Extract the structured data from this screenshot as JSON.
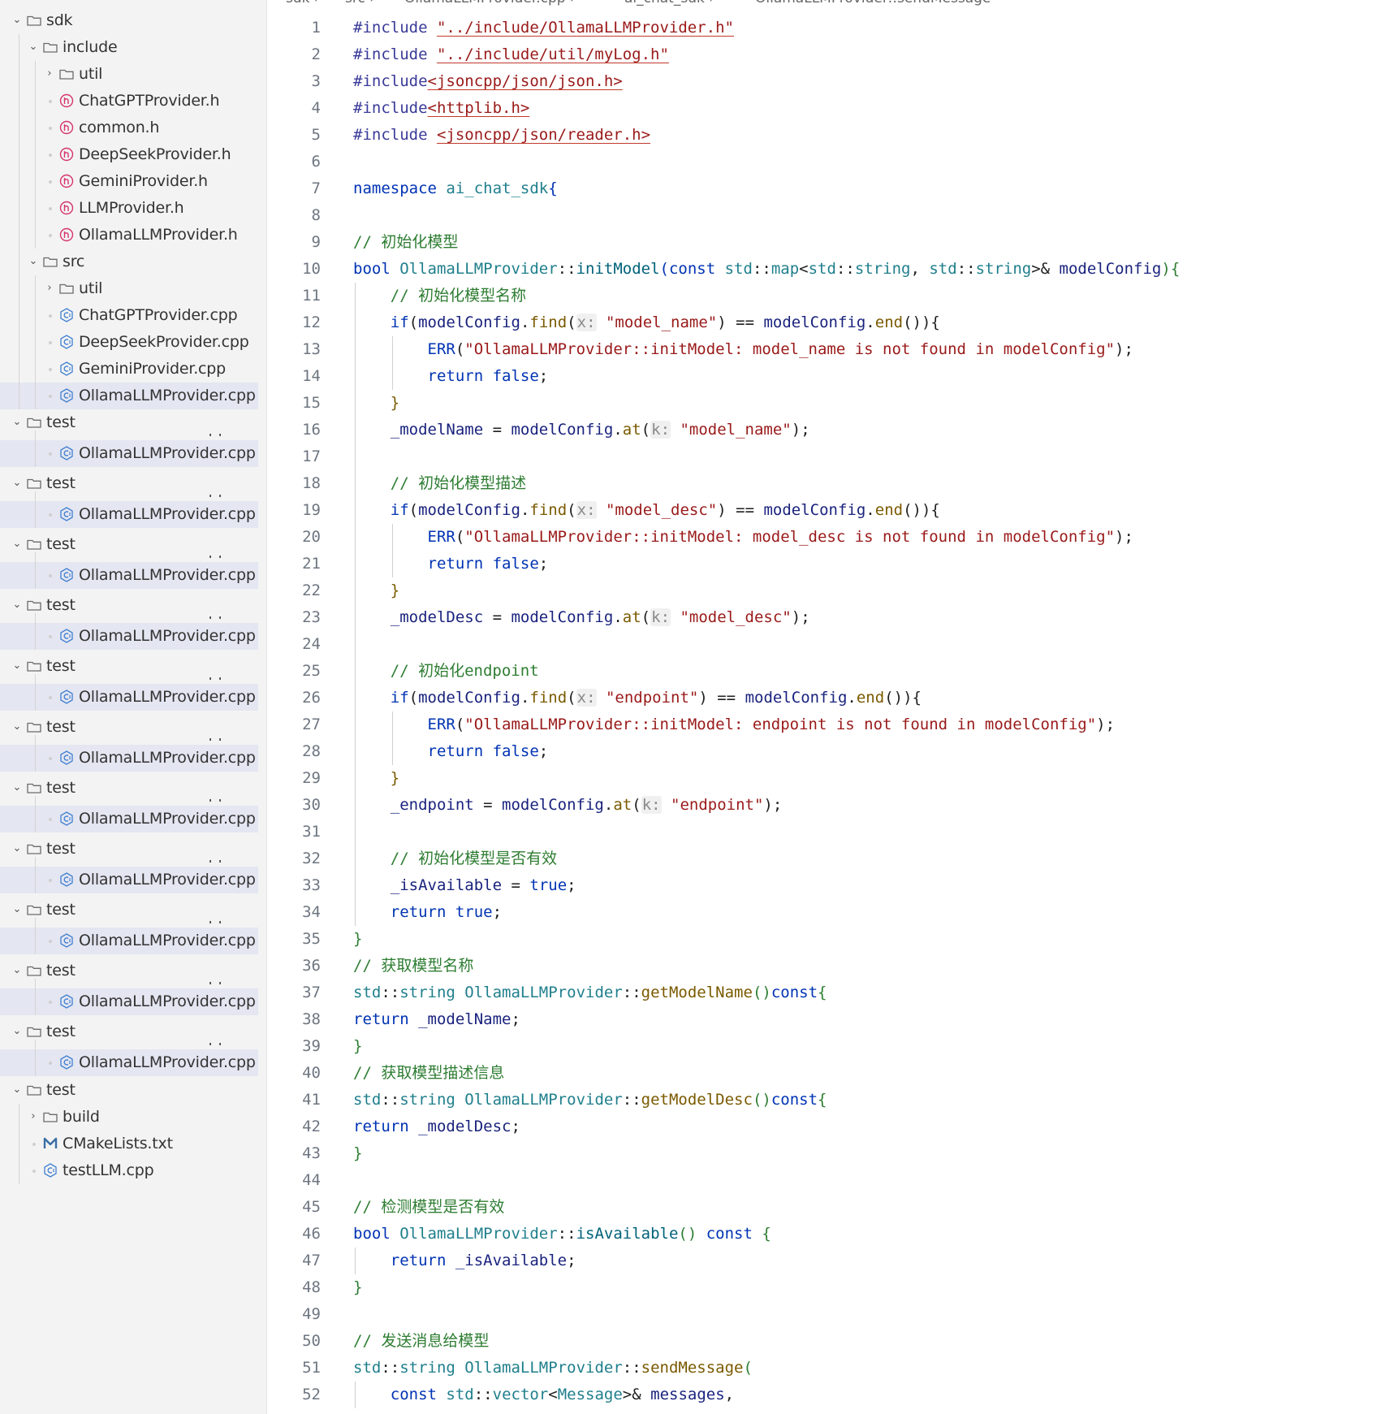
{
  "breadcrumb": [
    "sdk",
    "src",
    "OllamaLLMProvider.cpp",
    "ai_chat_sdk",
    "OllamaLLMProvider::sendMessage"
  ],
  "tree": [
    {
      "label": "sdk",
      "kind": "folder",
      "depth": 0,
      "expanded": true
    },
    {
      "label": "include",
      "kind": "folder",
      "depth": 1,
      "expanded": true
    },
    {
      "label": "util",
      "kind": "folder",
      "depth": 2,
      "expanded": false
    },
    {
      "label": "ChatGPTProvider.h",
      "kind": "header",
      "depth": 2
    },
    {
      "label": "common.h",
      "kind": "header",
      "depth": 2
    },
    {
      "label": "DeepSeekProvider.h",
      "kind": "header",
      "depth": 2
    },
    {
      "label": "GeminiProvider.h",
      "kind": "header",
      "depth": 2
    },
    {
      "label": "LLMProvider.h",
      "kind": "header",
      "depth": 2
    },
    {
      "label": "OllamaLLMProvider.h",
      "kind": "header",
      "depth": 2
    },
    {
      "label": "src",
      "kind": "folder",
      "depth": 1,
      "expanded": true
    },
    {
      "label": "util",
      "kind": "folder",
      "depth": 2,
      "expanded": false
    },
    {
      "label": "ChatGPTProvider.cpp",
      "kind": "cpp",
      "depth": 2
    },
    {
      "label": "DeepSeekProvider.cpp",
      "kind": "cpp",
      "depth": 2
    },
    {
      "label": "GeminiProvider.cpp",
      "kind": "cpp",
      "depth": 2
    },
    {
      "label": "OllamaLLMProvider.cpp",
      "kind": "cpp",
      "depth": 2,
      "selected": true
    }
  ],
  "ghost_label": "GeminiProvider.cpp",
  "repeat_group": {
    "folder": "test",
    "file": "OllamaLLMProvider.cpp",
    "count": 11
  },
  "tree_tail": [
    {
      "label": "test",
      "kind": "folder",
      "depth": 0,
      "expanded": true
    },
    {
      "label": "build",
      "kind": "folder",
      "depth": 1,
      "expanded": false
    },
    {
      "label": "CMakeLists.txt",
      "kind": "cmake",
      "depth": 1
    },
    {
      "label": "testLLM.cpp",
      "kind": "cpp",
      "depth": 1
    }
  ],
  "code_lines": [
    [
      [
        "#include ",
        "pp"
      ],
      [
        "\"../include/OllamaLLMProvider.h\"",
        "inc"
      ]
    ],
    [
      [
        "#include ",
        "pp"
      ],
      [
        "\"../include/util/myLog.h\"",
        "inc"
      ]
    ],
    [
      [
        "#include",
        "pp"
      ],
      [
        "<jsoncpp/json/json.h>",
        "inc"
      ]
    ],
    [
      [
        "#include",
        "pp"
      ],
      [
        "<httplib.h>",
        "inc"
      ]
    ],
    [
      [
        "#include ",
        "pp"
      ],
      [
        "<jsoncpp/json/reader.h>",
        "inc"
      ]
    ],
    [],
    [
      [
        "namespace ",
        "kw"
      ],
      [
        "ai_chat_sdk",
        "ty"
      ],
      [
        "{",
        "kw"
      ]
    ],
    [],
    [
      [
        "// 初始化模型",
        "cm"
      ]
    ],
    [
      [
        "bool ",
        "kw"
      ],
      [
        "OllamaLLMProvider",
        "ty"
      ],
      [
        "::",
        ""
      ],
      [
        "initModel",
        "fn"
      ],
      [
        "(",
        "kw"
      ],
      [
        "const ",
        "kw"
      ],
      [
        "std",
        "ty"
      ],
      [
        "::",
        ""
      ],
      [
        "map",
        "ty"
      ],
      [
        "<",
        ""
      ],
      [
        "std",
        "ty"
      ],
      [
        "::",
        ""
      ],
      [
        "string",
        "ty"
      ],
      [
        ", ",
        ""
      ],
      [
        "std",
        "ty"
      ],
      [
        "::",
        ""
      ],
      [
        "string",
        "ty"
      ],
      [
        ">& ",
        ""
      ],
      [
        "modelConfig",
        "var"
      ],
      [
        "){",
        "br"
      ]
    ],
    [
      [
        "    ",
        ""
      ],
      [
        "// 初始化模型名称",
        "cm"
      ]
    ],
    [
      [
        "    ",
        ""
      ],
      [
        "if",
        "kw"
      ],
      [
        "(",
        ""
      ],
      [
        "modelConfig",
        "var"
      ],
      [
        ".",
        ""
      ],
      [
        "find",
        "mt"
      ],
      [
        "(",
        ""
      ],
      [
        "x:",
        "hint"
      ],
      [
        " ",
        ""
      ],
      [
        "\"model_name\"",
        "str"
      ],
      [
        ") == ",
        ""
      ],
      [
        "modelConfig",
        "var"
      ],
      [
        ".",
        ""
      ],
      [
        "end",
        "mt"
      ],
      [
        "()){",
        ""
      ]
    ],
    [
      [
        "        ",
        ""
      ],
      [
        "ERR",
        "kw"
      ],
      [
        "(",
        ""
      ],
      [
        "\"OllamaLLMProvider::initModel: model_name is not found in modelConfig\"",
        "str"
      ],
      [
        ");",
        ""
      ]
    ],
    [
      [
        "        ",
        ""
      ],
      [
        "return ",
        "kw"
      ],
      [
        "false",
        "kw"
      ],
      [
        ";",
        ""
      ]
    ],
    [
      [
        "    ",
        ""
      ],
      [
        "}",
        "mt"
      ]
    ],
    [
      [
        "    ",
        ""
      ],
      [
        "_modelName",
        "var"
      ],
      [
        " = ",
        ""
      ],
      [
        "modelConfig",
        "var"
      ],
      [
        ".",
        ""
      ],
      [
        "at",
        "mt"
      ],
      [
        "(",
        ""
      ],
      [
        "k:",
        "hint"
      ],
      [
        " ",
        ""
      ],
      [
        "\"model_name\"",
        "str"
      ],
      [
        ");",
        ""
      ]
    ],
    [],
    [
      [
        "    ",
        ""
      ],
      [
        "// 初始化模型描述",
        "cm"
      ]
    ],
    [
      [
        "    ",
        ""
      ],
      [
        "if",
        "kw"
      ],
      [
        "(",
        ""
      ],
      [
        "modelConfig",
        "var"
      ],
      [
        ".",
        ""
      ],
      [
        "find",
        "mt"
      ],
      [
        "(",
        ""
      ],
      [
        "x:",
        "hint"
      ],
      [
        " ",
        ""
      ],
      [
        "\"model_desc\"",
        "str"
      ],
      [
        ") == ",
        ""
      ],
      [
        "modelConfig",
        "var"
      ],
      [
        ".",
        ""
      ],
      [
        "end",
        "mt"
      ],
      [
        "()){",
        ""
      ]
    ],
    [
      [
        "        ",
        ""
      ],
      [
        "ERR",
        "kw"
      ],
      [
        "(",
        ""
      ],
      [
        "\"OllamaLLMProvider::initModel: model_desc is not found in modelConfig\"",
        "str"
      ],
      [
        ");",
        ""
      ]
    ],
    [
      [
        "        ",
        ""
      ],
      [
        "return ",
        "kw"
      ],
      [
        "false",
        "kw"
      ],
      [
        ";",
        ""
      ]
    ],
    [
      [
        "    ",
        ""
      ],
      [
        "}",
        "mt"
      ]
    ],
    [
      [
        "    ",
        ""
      ],
      [
        "_modelDesc",
        "var"
      ],
      [
        " = ",
        ""
      ],
      [
        "modelConfig",
        "var"
      ],
      [
        ".",
        ""
      ],
      [
        "at",
        "mt"
      ],
      [
        "(",
        ""
      ],
      [
        "k:",
        "hint"
      ],
      [
        " ",
        ""
      ],
      [
        "\"model_desc\"",
        "str"
      ],
      [
        ");",
        ""
      ]
    ],
    [],
    [
      [
        "    ",
        ""
      ],
      [
        "// 初始化endpoint",
        "cm"
      ]
    ],
    [
      [
        "    ",
        ""
      ],
      [
        "if",
        "kw"
      ],
      [
        "(",
        ""
      ],
      [
        "modelConfig",
        "var"
      ],
      [
        ".",
        ""
      ],
      [
        "find",
        "mt"
      ],
      [
        "(",
        ""
      ],
      [
        "x:",
        "hint"
      ],
      [
        " ",
        ""
      ],
      [
        "\"endpoint\"",
        "str"
      ],
      [
        ") == ",
        ""
      ],
      [
        "modelConfig",
        "var"
      ],
      [
        ".",
        ""
      ],
      [
        "end",
        "mt"
      ],
      [
        "()){",
        ""
      ]
    ],
    [
      [
        "        ",
        ""
      ],
      [
        "ERR",
        "kw"
      ],
      [
        "(",
        ""
      ],
      [
        "\"OllamaLLMProvider::initModel: endpoint is not found in modelConfig\"",
        "str"
      ],
      [
        ");",
        ""
      ]
    ],
    [
      [
        "        ",
        ""
      ],
      [
        "return ",
        "kw"
      ],
      [
        "false",
        "kw"
      ],
      [
        ";",
        ""
      ]
    ],
    [
      [
        "    ",
        ""
      ],
      [
        "}",
        "mt"
      ]
    ],
    [
      [
        "    ",
        ""
      ],
      [
        "_endpoint",
        "var"
      ],
      [
        " = ",
        ""
      ],
      [
        "modelConfig",
        "var"
      ],
      [
        ".",
        ""
      ],
      [
        "at",
        "mt"
      ],
      [
        "(",
        ""
      ],
      [
        "k:",
        "hint"
      ],
      [
        " ",
        ""
      ],
      [
        "\"endpoint\"",
        "str"
      ],
      [
        ");",
        ""
      ]
    ],
    [],
    [
      [
        "    ",
        ""
      ],
      [
        "// 初始化模型是否有效",
        "cm"
      ]
    ],
    [
      [
        "    ",
        ""
      ],
      [
        "_isAvailable",
        "var"
      ],
      [
        " = ",
        ""
      ],
      [
        "true",
        "kw"
      ],
      [
        ";",
        ""
      ]
    ],
    [
      [
        "    ",
        ""
      ],
      [
        "return ",
        "kw"
      ],
      [
        "true",
        "kw"
      ],
      [
        ";",
        ""
      ]
    ],
    [
      [
        "}",
        "br"
      ]
    ],
    [
      [
        "// 获取模型名称",
        "cm"
      ]
    ],
    [
      [
        "std",
        "ty"
      ],
      [
        "::",
        ""
      ],
      [
        "string ",
        "ty"
      ],
      [
        "OllamaLLMProvider",
        "ty"
      ],
      [
        "::",
        ""
      ],
      [
        "getModelName",
        "mt"
      ],
      [
        "()",
        "br"
      ],
      [
        "const",
        "kw"
      ],
      [
        "{",
        "br"
      ]
    ],
    [
      [
        "return ",
        "kw"
      ],
      [
        "_modelName",
        "var"
      ],
      [
        ";",
        ""
      ]
    ],
    [
      [
        "}",
        "br"
      ]
    ],
    [
      [
        "// 获取模型描述信息",
        "cm"
      ]
    ],
    [
      [
        "std",
        "ty"
      ],
      [
        "::",
        ""
      ],
      [
        "string ",
        "ty"
      ],
      [
        "OllamaLLMProvider",
        "ty"
      ],
      [
        "::",
        ""
      ],
      [
        "getModelDesc",
        "mt"
      ],
      [
        "()",
        "br"
      ],
      [
        "const",
        "kw"
      ],
      [
        "{",
        "br"
      ]
    ],
    [
      [
        "return ",
        "kw"
      ],
      [
        "_modelDesc",
        "var"
      ],
      [
        ";",
        ""
      ]
    ],
    [
      [
        "}",
        "br"
      ]
    ],
    [],
    [
      [
        "// 检测模型是否有效",
        "cm"
      ]
    ],
    [
      [
        "bool ",
        "kw"
      ],
      [
        "OllamaLLMProvider",
        "ty"
      ],
      [
        "::",
        ""
      ],
      [
        "isAvailable",
        "fn"
      ],
      [
        "() ",
        "br"
      ],
      [
        "const ",
        "kw"
      ],
      [
        "{",
        "br"
      ]
    ],
    [
      [
        "    ",
        ""
      ],
      [
        "return ",
        "kw"
      ],
      [
        "_isAvailable",
        "var"
      ],
      [
        ";",
        ""
      ]
    ],
    [
      [
        "}",
        "br"
      ]
    ],
    [],
    [
      [
        "// 发送消息给模型",
        "cm"
      ]
    ],
    [
      [
        "std",
        "ty"
      ],
      [
        "::",
        ""
      ],
      [
        "string ",
        "ty"
      ],
      [
        "OllamaLLMProvider",
        "ty"
      ],
      [
        "::",
        ""
      ],
      [
        "sendMessage",
        "mt"
      ],
      [
        "(",
        "br"
      ]
    ],
    [
      [
        "    ",
        ""
      ],
      [
        "const ",
        "kw"
      ],
      [
        "std",
        "ty"
      ],
      [
        "::",
        ""
      ],
      [
        "vector",
        "ty"
      ],
      [
        "<",
        ""
      ],
      [
        "Message",
        "ty"
      ],
      [
        ">& ",
        ""
      ],
      [
        "messages",
        "var"
      ],
      [
        ",",
        ""
      ]
    ]
  ]
}
